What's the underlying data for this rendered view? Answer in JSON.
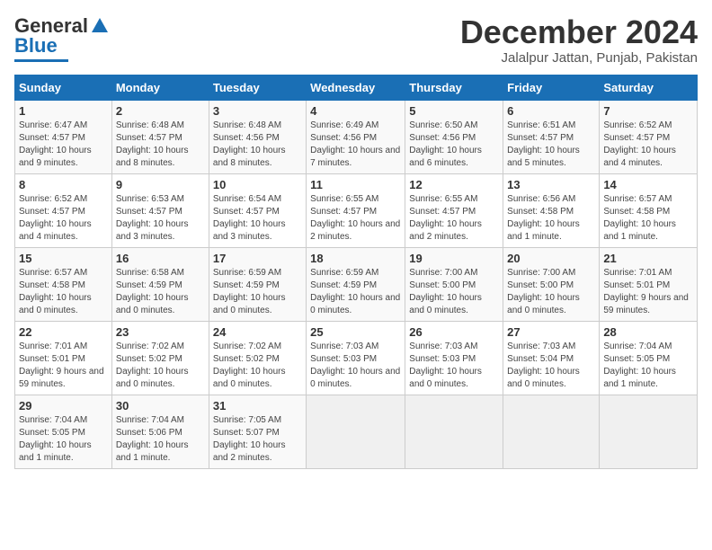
{
  "header": {
    "logo_general": "General",
    "logo_blue": "Blue",
    "month": "December 2024",
    "location": "Jalalpur Jattan, Punjab, Pakistan"
  },
  "weekdays": [
    "Sunday",
    "Monday",
    "Tuesday",
    "Wednesday",
    "Thursday",
    "Friday",
    "Saturday"
  ],
  "weeks": [
    [
      {
        "day": "1",
        "sunrise": "6:47 AM",
        "sunset": "4:57 PM",
        "daylight": "10 hours and 9 minutes."
      },
      {
        "day": "2",
        "sunrise": "6:48 AM",
        "sunset": "4:57 PM",
        "daylight": "10 hours and 8 minutes."
      },
      {
        "day": "3",
        "sunrise": "6:48 AM",
        "sunset": "4:56 PM",
        "daylight": "10 hours and 8 minutes."
      },
      {
        "day": "4",
        "sunrise": "6:49 AM",
        "sunset": "4:56 PM",
        "daylight": "10 hours and 7 minutes."
      },
      {
        "day": "5",
        "sunrise": "6:50 AM",
        "sunset": "4:56 PM",
        "daylight": "10 hours and 6 minutes."
      },
      {
        "day": "6",
        "sunrise": "6:51 AM",
        "sunset": "4:57 PM",
        "daylight": "10 hours and 5 minutes."
      },
      {
        "day": "7",
        "sunrise": "6:52 AM",
        "sunset": "4:57 PM",
        "daylight": "10 hours and 4 minutes."
      }
    ],
    [
      {
        "day": "8",
        "sunrise": "6:52 AM",
        "sunset": "4:57 PM",
        "daylight": "10 hours and 4 minutes."
      },
      {
        "day": "9",
        "sunrise": "6:53 AM",
        "sunset": "4:57 PM",
        "daylight": "10 hours and 3 minutes."
      },
      {
        "day": "10",
        "sunrise": "6:54 AM",
        "sunset": "4:57 PM",
        "daylight": "10 hours and 3 minutes."
      },
      {
        "day": "11",
        "sunrise": "6:55 AM",
        "sunset": "4:57 PM",
        "daylight": "10 hours and 2 minutes."
      },
      {
        "day": "12",
        "sunrise": "6:55 AM",
        "sunset": "4:57 PM",
        "daylight": "10 hours and 2 minutes."
      },
      {
        "day": "13",
        "sunrise": "6:56 AM",
        "sunset": "4:58 PM",
        "daylight": "10 hours and 1 minute."
      },
      {
        "day": "14",
        "sunrise": "6:57 AM",
        "sunset": "4:58 PM",
        "daylight": "10 hours and 1 minute."
      }
    ],
    [
      {
        "day": "15",
        "sunrise": "6:57 AM",
        "sunset": "4:58 PM",
        "daylight": "10 hours and 0 minutes."
      },
      {
        "day": "16",
        "sunrise": "6:58 AM",
        "sunset": "4:59 PM",
        "daylight": "10 hours and 0 minutes."
      },
      {
        "day": "17",
        "sunrise": "6:59 AM",
        "sunset": "4:59 PM",
        "daylight": "10 hours and 0 minutes."
      },
      {
        "day": "18",
        "sunrise": "6:59 AM",
        "sunset": "4:59 PM",
        "daylight": "10 hours and 0 minutes."
      },
      {
        "day": "19",
        "sunrise": "7:00 AM",
        "sunset": "5:00 PM",
        "daylight": "10 hours and 0 minutes."
      },
      {
        "day": "20",
        "sunrise": "7:00 AM",
        "sunset": "5:00 PM",
        "daylight": "10 hours and 0 minutes."
      },
      {
        "day": "21",
        "sunrise": "7:01 AM",
        "sunset": "5:01 PM",
        "daylight": "9 hours and 59 minutes."
      }
    ],
    [
      {
        "day": "22",
        "sunrise": "7:01 AM",
        "sunset": "5:01 PM",
        "daylight": "9 hours and 59 minutes."
      },
      {
        "day": "23",
        "sunrise": "7:02 AM",
        "sunset": "5:02 PM",
        "daylight": "10 hours and 0 minutes."
      },
      {
        "day": "24",
        "sunrise": "7:02 AM",
        "sunset": "5:02 PM",
        "daylight": "10 hours and 0 minutes."
      },
      {
        "day": "25",
        "sunrise": "7:03 AM",
        "sunset": "5:03 PM",
        "daylight": "10 hours and 0 minutes."
      },
      {
        "day": "26",
        "sunrise": "7:03 AM",
        "sunset": "5:03 PM",
        "daylight": "10 hours and 0 minutes."
      },
      {
        "day": "27",
        "sunrise": "7:03 AM",
        "sunset": "5:04 PM",
        "daylight": "10 hours and 0 minutes."
      },
      {
        "day": "28",
        "sunrise": "7:04 AM",
        "sunset": "5:05 PM",
        "daylight": "10 hours and 1 minute."
      }
    ],
    [
      {
        "day": "29",
        "sunrise": "7:04 AM",
        "sunset": "5:05 PM",
        "daylight": "10 hours and 1 minute."
      },
      {
        "day": "30",
        "sunrise": "7:04 AM",
        "sunset": "5:06 PM",
        "daylight": "10 hours and 1 minute."
      },
      {
        "day": "31",
        "sunrise": "7:05 AM",
        "sunset": "5:07 PM",
        "daylight": "10 hours and 2 minutes."
      },
      null,
      null,
      null,
      null
    ]
  ]
}
